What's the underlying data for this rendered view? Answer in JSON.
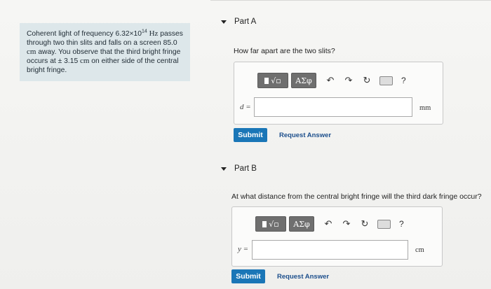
{
  "problem": {
    "text_1": "Coherent light of frequency 6.32×10",
    "text_1_sup": "14",
    "text_1_unit": " Hz",
    "text_1_tail": " passes through two thin slits and falls on a screen 85.0",
    "text_2_unit": " cm",
    "text_3": " away. You observe that the third bright fringe occurs at ± 3.15",
    "text_3_unit": " cm",
    "text_4": " on either side of the central bright fringe."
  },
  "parts": [
    {
      "label": "Part A",
      "question": "How far apart are the two slits?",
      "variable": "d =",
      "input_value": "",
      "unit": "mm",
      "submit_label": "Submit",
      "request_label": "Request Answer"
    },
    {
      "label": "Part B",
      "question": "At what distance from the central bright fringe will the third dark fringe occur?",
      "variable": "y =",
      "input_value": "",
      "unit": "cm",
      "submit_label": "Submit",
      "request_label": "Request Answer"
    }
  ],
  "toolbar": {
    "radical_label": "√▫",
    "greek_label": "ΑΣφ",
    "undo_icon": "undo-icon",
    "redo_icon": "redo-icon",
    "reset_icon": "reset-icon",
    "keyboard_icon": "keyboard-icon",
    "help_label": "?"
  },
  "colors": {
    "submit": "#1a76b7",
    "link": "#1d4f8c",
    "problem_bg": "#dde7ea",
    "toolbar_btn": "#6f6f6f"
  }
}
